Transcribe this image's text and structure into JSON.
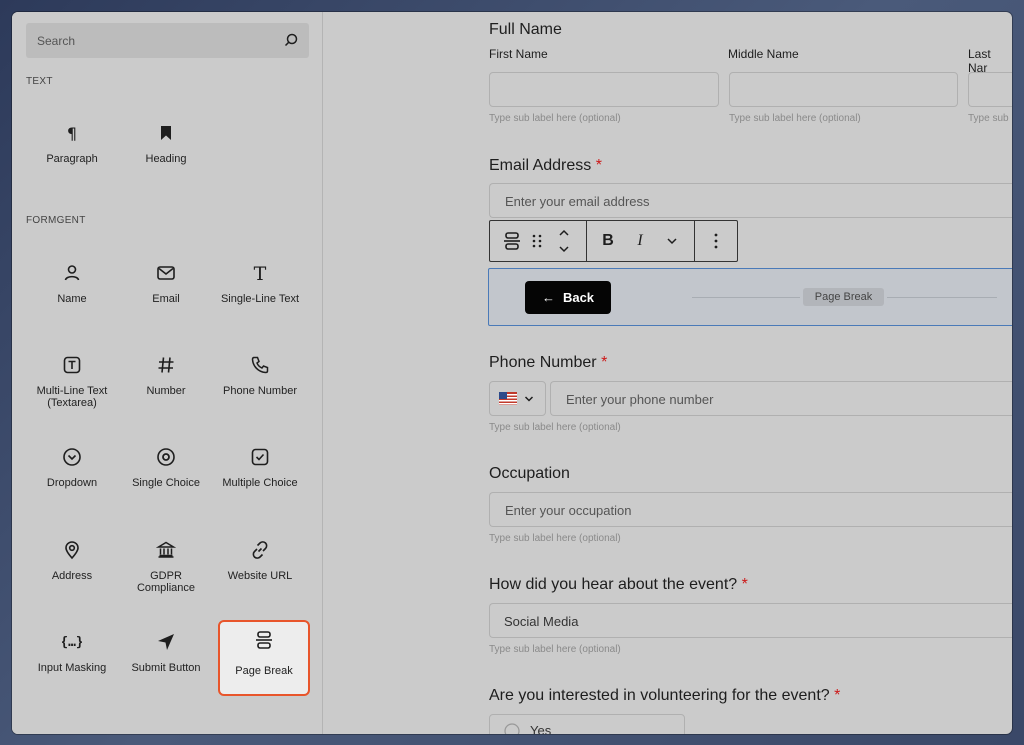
{
  "sidebar": {
    "search_placeholder": "Search",
    "section_text": "TEXT",
    "section_formgent": "FORMGENT",
    "text_blocks": [
      {
        "label": "Paragraph",
        "icon": "paragraph-icon"
      },
      {
        "label": "Heading",
        "icon": "bookmark-icon"
      }
    ],
    "formgent_blocks": [
      {
        "label": "Name",
        "icon": "user-icon"
      },
      {
        "label": "Email",
        "icon": "envelope-icon"
      },
      {
        "label": "Single-Line Text",
        "icon": "text-t-icon"
      },
      {
        "label": "Multi-Line Text (Textarea)",
        "icon": "text-box-icon"
      },
      {
        "label": "Number",
        "icon": "hash-icon"
      },
      {
        "label": "Phone Number",
        "icon": "phone-icon"
      },
      {
        "label": "Dropdown",
        "icon": "circle-chevron-icon"
      },
      {
        "label": "Single Choice",
        "icon": "radio-icon"
      },
      {
        "label": "Multiple Choice",
        "icon": "checkbox-icon"
      },
      {
        "label": "Address",
        "icon": "map-pin-icon"
      },
      {
        "label": "GDPR Compliance",
        "icon": "bank-icon"
      },
      {
        "label": "Website URL",
        "icon": "link-icon"
      },
      {
        "label": "Input Masking",
        "icon": "braces-icon"
      },
      {
        "label": "Submit Button",
        "icon": "send-icon"
      },
      {
        "label": "Page Break",
        "icon": "page-break-icon",
        "selected": true
      }
    ]
  },
  "form": {
    "full_name": {
      "label": "Full Name",
      "first": "First Name",
      "middle": "Middle Name",
      "last": "Last Nar",
      "hint": "Type sub label here (optional)",
      "hint_cut": "Type sub"
    },
    "email": {
      "label": "Email Address",
      "required": "*",
      "placeholder": "Enter your email address"
    },
    "page_break": {
      "back_label": "Back",
      "tag": "Page Break"
    },
    "phone": {
      "label": "Phone Number",
      "required": "*",
      "placeholder": "Enter your phone number",
      "hint": "Type sub label here (optional)"
    },
    "occupation": {
      "label": "Occupation",
      "placeholder": "Enter your occupation",
      "hint": "Type sub label here (optional)"
    },
    "hear": {
      "label": "How did you hear about the event?",
      "required": "*",
      "value": "Social Media",
      "hint": "Type sub label here (optional)"
    },
    "volunteer": {
      "label": "Are you interested in volunteering for the event?",
      "required": "*",
      "option_yes": "Yes"
    }
  },
  "colors": {
    "accent": "#e8552b",
    "required": "#cc1818",
    "selection_border": "#4a7ab8"
  }
}
